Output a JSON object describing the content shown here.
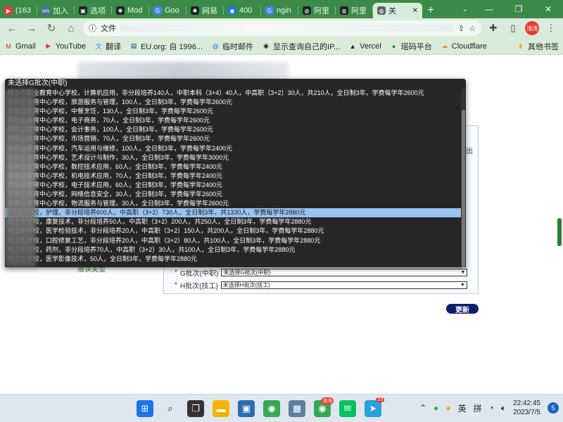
{
  "browser": {
    "tabs": [
      {
        "label": "(163",
        "icon": "youtube-icon",
        "color": "#e53935",
        "glyph": "▶"
      },
      {
        "label": "加入",
        "icon": "vmware-icon",
        "color": "#4a6fa5",
        "glyph": "vm"
      },
      {
        "label": "选项",
        "icon": "app-icon",
        "color": "#222222",
        "glyph": "▣"
      },
      {
        "label": "Mod",
        "icon": "openai-icon",
        "color": "#202124",
        "glyph": "✺"
      },
      {
        "label": "Goo",
        "icon": "translate-icon",
        "color": "#4285f4",
        "glyph": "G"
      },
      {
        "label": "网易",
        "icon": "openai-icon",
        "color": "#202124",
        "glyph": "✺"
      },
      {
        "label": "400",
        "icon": "stack-icon",
        "color": "#1a73e8",
        "glyph": "◉"
      },
      {
        "label": "ngin",
        "icon": "google-icon",
        "color": "#4285f4",
        "glyph": "G"
      },
      {
        "label": "阿里",
        "icon": "web-icon",
        "color": "#202124",
        "glyph": "◍"
      },
      {
        "label": "阿里",
        "icon": "web-icon",
        "color": "#202124",
        "glyph": "◍"
      },
      {
        "label": "关",
        "icon": "globe-icon",
        "color": "#5f6368",
        "glyph": "◍"
      }
    ],
    "new_tab": "+",
    "url_prefix": "文件",
    "profile_label": "浅浅"
  },
  "bookmarks": [
    {
      "label": "Gmail",
      "icon": "gmail-icon",
      "color": "#d93025",
      "glyph": "M"
    },
    {
      "label": "YouTube",
      "icon": "youtube-icon",
      "color": "#e53935",
      "glyph": "▶"
    },
    {
      "label": "翻译",
      "icon": "translate-icon",
      "color": "#4285f4",
      "glyph": "文"
    },
    {
      "label": "EU.org: 自 1996...",
      "icon": "eu-icon",
      "color": "#1a3c8c",
      "glyph": "▤"
    },
    {
      "label": "临时邮件",
      "icon": "mail-icon",
      "color": "#1a73e8",
      "glyph": "@"
    },
    {
      "label": "显示查询自己的IP...",
      "icon": "ip-icon",
      "color": "#202124",
      "glyph": "◉"
    },
    {
      "label": "Vercel",
      "icon": "vercel-icon",
      "color": "#000000",
      "glyph": "▲"
    },
    {
      "label": "瑶码平台",
      "icon": "platform-icon",
      "color": "#2e7d32",
      "glyph": "●"
    },
    {
      "label": "Cloudflare",
      "icon": "cloudflare-icon",
      "color": "#f38020",
      "glyph": "☁"
    }
  ],
  "bookmarks_other": "其他书签",
  "dropdown": {
    "header": "未选择G批次(中职)",
    "options": [
      "哈尔市职业教育中心学校，计算机应用，非分段培养140人，中职本科（3+4）40人，中高职（3+2）30人，共210人，全日制3年，学费每学年2600元",
      "市职业教育中心学校，旅游服务与管理，100人，全日制3年，学费每学年2600元",
      "市职业教育中心学校，中餐烹饪，130人，全日制3年，学费每学年2600元",
      "市职业教育中心学校，电子商务，70人，全日制3年，学费每学年2600元",
      "市职业教育中心学校，会计事务，100人，全日制3年，学费每学年2600元",
      "市职业教育中心学校，市场营销，70人，全日制3年，学费每学年2600元",
      "市职业教育中心学校，汽车运用与维修，100人，全日制3年，学费每学年2400元",
      "市职业教育中心学校，艺术设计与制作，30人，全日制3年，学费每学年3000元",
      "市职业教育中心学校，数控技术应用，60人，全日制3年，学费每学年2400元",
      "市职业教育中心学校，机电技术应用，70人，全日制3年，学费每学年2400元",
      "市职业教育中心学校，电子技术应用，60人，全日制3年，学费每学年2400元",
      "市职业教育中心学校，网络信息安全，30人，全日制3年，学费每学年2600元",
      "市职业教育中心学校，物流服务与管理，30人，全日制3年，学费每学年2600元",
      "市卫生学校，护理，非分段培养600人，中高职（3+2）730人，全日制3年，共1330人，学费每学年2880元",
      "市卫生学校，康复技术，非分段培养50人，中高职（3+2）200人，共250人，全日制3年，学费每学年2880元",
      "市卫生学校，医学检验技术，非分段培养20人，中高职（3+2）150人，共200人，全日制3年，学费每学年2880元",
      "市卫生学校，口腔修复工艺，非分段培养20人，中高职（3+2）80人，共100人，全日制3年，学费每学年2880元",
      "市卫生学校，药剂，非分段培养70人，中高职（3+2）30人，共100人，全日制3年，学费每学年2880元",
      "市卫生学校，医学影像技术，50人，全日制3年，学费每学年2880元"
    ],
    "selected_index": 13
  },
  "form": {
    "side_note": "出",
    "g_label": "G批次(中职)",
    "g_value": "未选择G批次(中职)",
    "h_label": "H批次(技工)",
    "h_value": "未选择H批次(技工)",
    "required_mark": "*",
    "update_label": "更新",
    "stray_label": "报读类型"
  },
  "taskbar": {
    "time": "22:42:45",
    "date": "2023/7/5",
    "ime_lang": "英",
    "ime_mode": "拼",
    "notification_count": "5",
    "wechat_badge": "",
    "telegram_badge": "23"
  }
}
